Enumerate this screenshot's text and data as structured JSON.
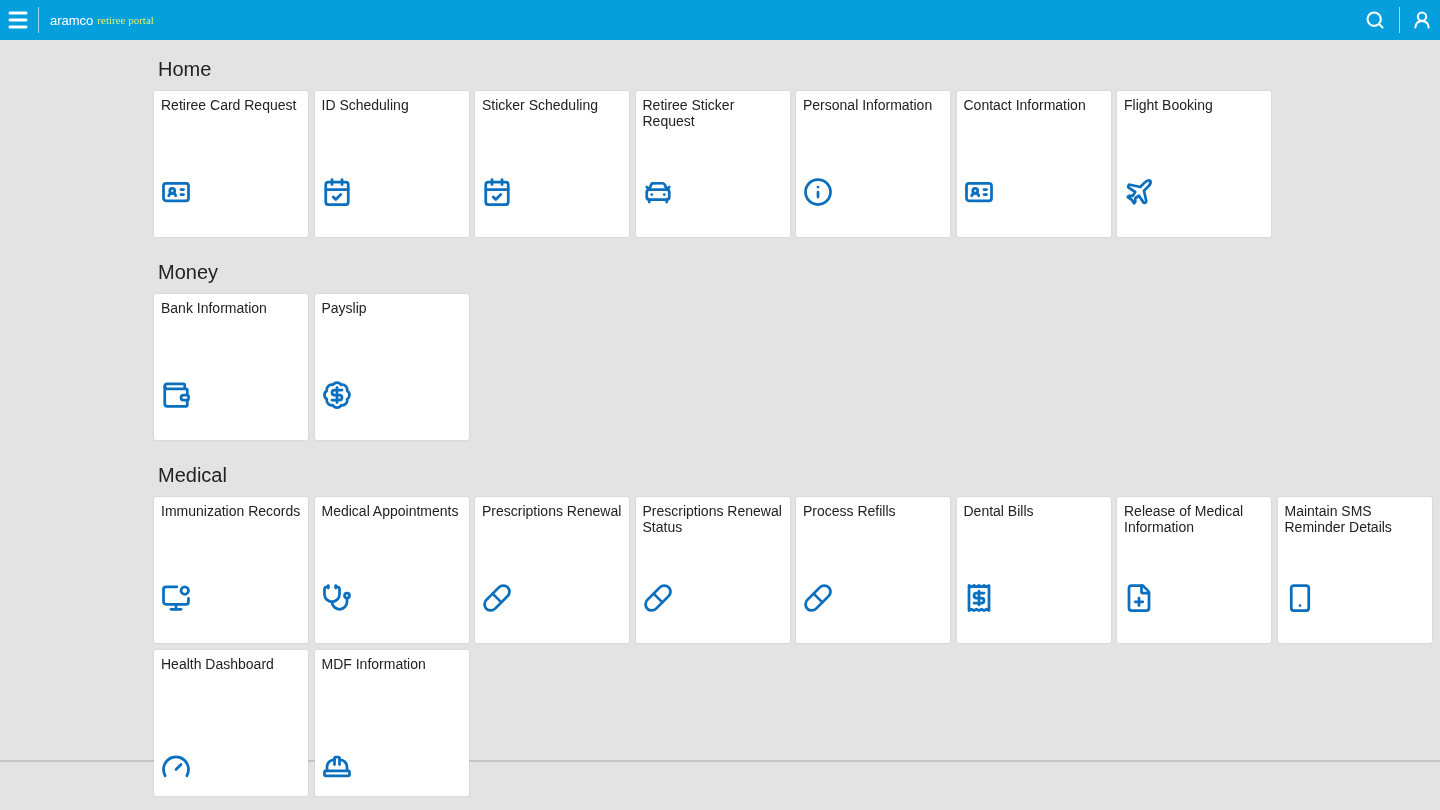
{
  "header": {
    "brand": "aramco",
    "subtitle": "retiree portal"
  },
  "sections": [
    {
      "title": "Home",
      "tiles": [
        {
          "label": "Retiree Card Request"
        },
        {
          "label": "ID Scheduling"
        },
        {
          "label": "Sticker Scheduling"
        },
        {
          "label": "Retiree Sticker Request"
        },
        {
          "label": "Personal Information"
        },
        {
          "label": "Contact Information"
        },
        {
          "label": "Flight Booking"
        }
      ]
    },
    {
      "title": "Money",
      "tiles": [
        {
          "label": "Bank Information"
        },
        {
          "label": "Payslip"
        }
      ]
    },
    {
      "title": "Medical",
      "tiles": [
        {
          "label": "Immunization Records"
        },
        {
          "label": "Medical Appointments"
        },
        {
          "label": "Prescriptions Renewal"
        },
        {
          "label": "Prescriptions Renewal Status"
        },
        {
          "label": "Process Refills"
        },
        {
          "label": "Dental Bills"
        },
        {
          "label": "Release of Medical Information"
        },
        {
          "label": "Maintain SMS Reminder Details"
        },
        {
          "label": "Health Dashboard"
        },
        {
          "label": "MDF Information"
        }
      ]
    }
  ]
}
